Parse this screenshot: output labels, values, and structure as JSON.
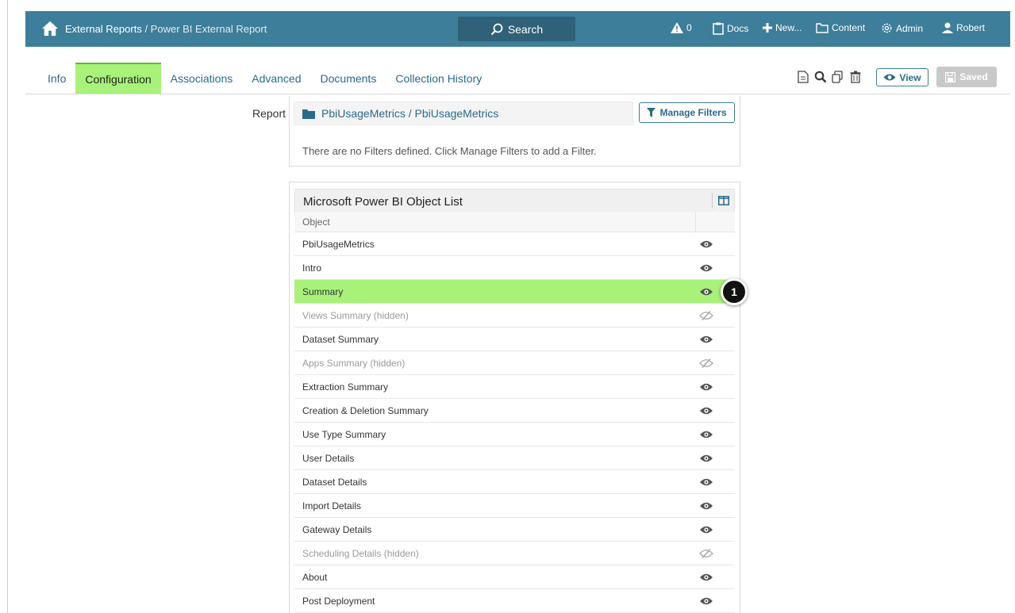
{
  "topbar": {
    "breadcrumb_root": "External Reports",
    "breadcrumb_sep": " / ",
    "breadcrumb_current": "Power BI External Report",
    "search_label": "Search",
    "alerts_count": "0",
    "docs_label": "Docs",
    "new_label": "New...",
    "content_label": "Content",
    "admin_label": "Admin",
    "user_label": "Robert"
  },
  "tabs": [
    {
      "label": "Info"
    },
    {
      "label": "Configuration"
    },
    {
      "label": "Associations"
    },
    {
      "label": "Advanced"
    },
    {
      "label": "Documents"
    },
    {
      "label": "Collection History"
    }
  ],
  "actions": {
    "view_label": "View",
    "saved_label": "Saved"
  },
  "report": {
    "label": "Report",
    "path": "PbiUsageMetrics / PbiUsageMetrics",
    "manage_filters_label": "Manage Filters",
    "no_filters_text": "There are no Filters defined. Click Manage Filters to add a Filter."
  },
  "object_list": {
    "title": "Microsoft Power BI Object List",
    "column_header": "Object",
    "rows": [
      {
        "label": "PbiUsageMetrics",
        "hidden": false
      },
      {
        "label": "Intro",
        "hidden": false
      },
      {
        "label": "Summary",
        "hidden": false,
        "selected": true
      },
      {
        "label": "Views Summary (hidden)",
        "hidden": true
      },
      {
        "label": "Dataset Summary",
        "hidden": false
      },
      {
        "label": "Apps Summary (hidden)",
        "hidden": true
      },
      {
        "label": "Extraction Summary",
        "hidden": false
      },
      {
        "label": "Creation & Deletion Summary",
        "hidden": false
      },
      {
        "label": "Use Type Summary",
        "hidden": false
      },
      {
        "label": "User Details",
        "hidden": false
      },
      {
        "label": "Dataset Details",
        "hidden": false
      },
      {
        "label": "Import Details",
        "hidden": false
      },
      {
        "label": "Gateway Details",
        "hidden": false
      },
      {
        "label": "Scheduling Details (hidden)",
        "hidden": true
      },
      {
        "label": "About",
        "hidden": false
      },
      {
        "label": "Post Deployment",
        "hidden": false
      }
    ]
  },
  "callout": {
    "number": "1"
  },
  "colors": {
    "topbar": "#3d7e9a",
    "active_tab": "#a8f27a",
    "link": "#2a6b8a"
  }
}
